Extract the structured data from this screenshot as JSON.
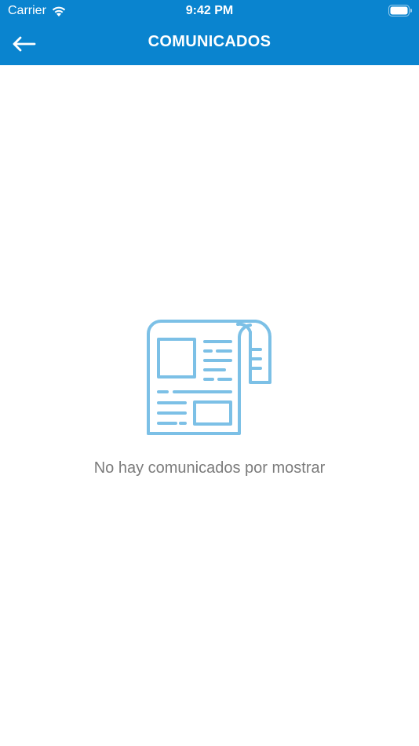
{
  "status_bar": {
    "carrier": "Carrier",
    "time": "9:42 PM",
    "wifi_icon": "wifi-icon",
    "battery_icon": "battery-icon"
  },
  "nav": {
    "title": "COMUNICADOS",
    "back_icon": "arrow-left-icon",
    "background_color": "#0a84cf"
  },
  "empty_state": {
    "icon": "newspaper-icon",
    "icon_color": "#7cc0e6",
    "message": "No hay comunicados por mostrar"
  }
}
